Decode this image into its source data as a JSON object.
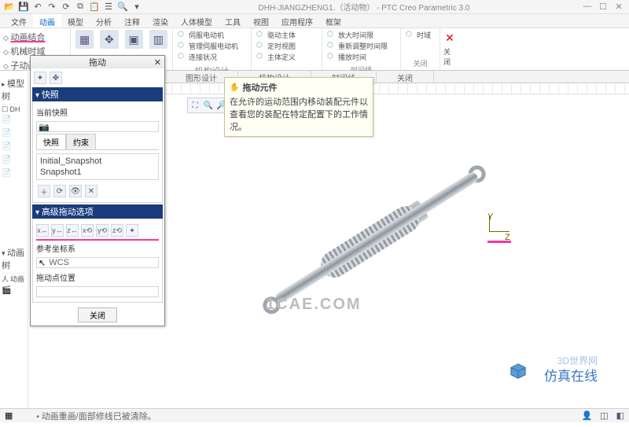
{
  "title": "DHH-JIANGZHENG1.（活动物） - PTC Creo Parametric 3.0",
  "qat": [
    "open",
    "save",
    "undo",
    "redo",
    "regen",
    "copy",
    "paste",
    "close",
    "search",
    "win"
  ],
  "menus": [
    "文件",
    "动画",
    "模型",
    "分析",
    "注释",
    "渲染",
    "人体模型",
    "工具",
    "视图",
    "应用程序",
    "框架"
  ],
  "active_menu": "动画",
  "ribbon": {
    "left_items": [
      "动画结合",
      "机械时域",
      "子动画"
    ],
    "group_icons1": "图形设计",
    "group_icons2": "机构设计",
    "mech_items": [
      "伺服电动机",
      "管理伺服电动机",
      "连接状况"
    ],
    "mech2_items": [
      "驱动主体",
      "定时视图",
      "主体定义"
    ],
    "mech3_items": [
      "放大时间限",
      "重新调整时间限",
      "播放时间"
    ],
    "time_col": "时间线",
    "timeline_item": "时域",
    "close_col": "关闭",
    "close_label": "关闭"
  },
  "view_tabs": [
    "图形设计",
    "机构设计",
    "时间线",
    "关闭"
  ],
  "dialog": {
    "title": "拖动",
    "section1": "快照",
    "current": "当前快照",
    "tab_snapshot": "快照",
    "tab_constraint": "约束",
    "snapshots": [
      "Initial_Snapshot",
      "Snapshot1"
    ],
    "section2": "高级拖动选项",
    "ref_label": "参考坐标系",
    "ref_value": "WCS",
    "pt_label": "拖动点位置",
    "close": "关闭"
  },
  "tooltip": {
    "title": "拖动元件",
    "body": "在允许的运动范围内移动装配元件以查看您的装配在特定配置下的工作情况。"
  },
  "csys": {
    "y": "Y",
    "z": "Z"
  },
  "watermark1": "1CAE.COM",
  "watermark2": "仿真在线",
  "brand_small": "3D世界网",
  "tree": {
    "hdr1": "模型树",
    "hdr2": "动画树",
    "item": "DH",
    "sub": "动画"
  },
  "status": "动画重画/面部修线已被清除。"
}
